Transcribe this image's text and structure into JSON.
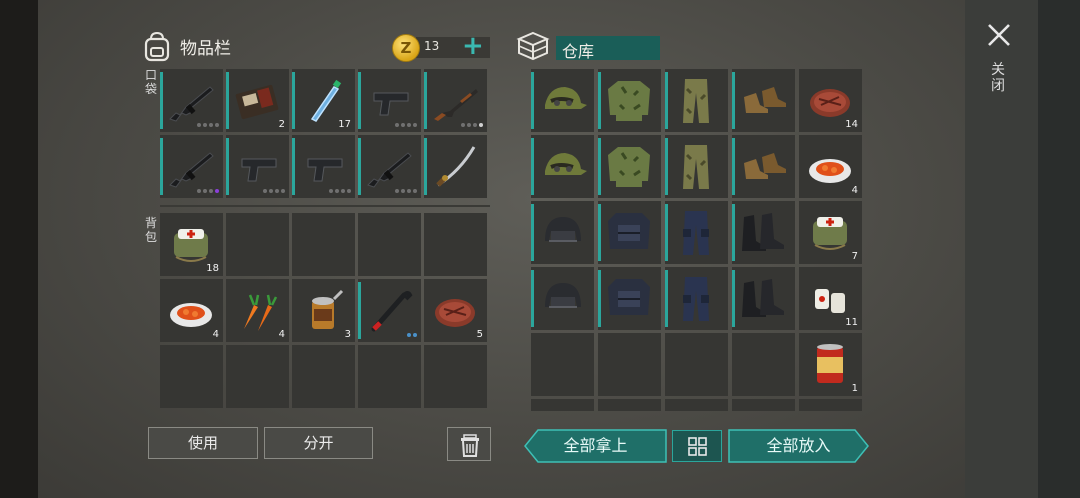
{
  "inventory": {
    "title": "物品栏",
    "coins": "13",
    "plus_label": "+",
    "pocket_label": "口袋",
    "backpack_label": "背包",
    "pocket_slots": [
      {
        "item": "assault-rifle",
        "qty": "",
        "dots": [
          "g",
          "g",
          "g",
          "g"
        ]
      },
      {
        "item": "wallet",
        "qty": "2",
        "dots": []
      },
      {
        "item": "water-bottle",
        "qty": "17",
        "dots": []
      },
      {
        "item": "pistol",
        "qty": "",
        "dots": [
          "g",
          "g",
          "g",
          "g"
        ]
      },
      {
        "item": "ak-rifle",
        "qty": "",
        "dots": [
          "g",
          "g",
          "g",
          "w"
        ]
      },
      {
        "item": "assault-rifle",
        "qty": "",
        "dots": [
          "g",
          "g",
          "g",
          "p"
        ]
      },
      {
        "item": "pistol",
        "qty": "",
        "dots": [
          "g",
          "g",
          "g",
          "g"
        ]
      },
      {
        "item": "pistol",
        "qty": "",
        "dots": [
          "g",
          "g",
          "g",
          "g"
        ]
      },
      {
        "item": "assault-rifle",
        "qty": "",
        "dots": [
          "g",
          "g",
          "g",
          "g"
        ]
      },
      {
        "item": "katana",
        "qty": "",
        "dots": []
      }
    ],
    "backpack_slots": [
      {
        "item": "medkit",
        "qty": "18",
        "dots": []
      },
      {
        "item": "",
        "qty": "",
        "dots": []
      },
      {
        "item": "",
        "qty": "",
        "dots": []
      },
      {
        "item": "",
        "qty": "",
        "dots": []
      },
      {
        "item": "",
        "qty": "",
        "dots": []
      },
      {
        "item": "carrot-stew",
        "qty": "4",
        "dots": []
      },
      {
        "item": "carrots",
        "qty": "4",
        "dots": []
      },
      {
        "item": "open-can",
        "qty": "3",
        "dots": []
      },
      {
        "item": "crowbar",
        "qty": "",
        "dots": [
          "b",
          "b"
        ]
      },
      {
        "item": "steak",
        "qty": "5",
        "dots": []
      },
      {
        "item": "",
        "qty": "",
        "dots": []
      },
      {
        "item": "",
        "qty": "",
        "dots": []
      },
      {
        "item": "",
        "qty": "",
        "dots": []
      },
      {
        "item": "",
        "qty": "",
        "dots": []
      },
      {
        "item": "",
        "qty": "",
        "dots": []
      }
    ],
    "use_label": "使用",
    "split_label": "分开"
  },
  "warehouse": {
    "title": "仓库",
    "slots": [
      {
        "item": "camo-cap",
        "qty": "",
        "mark": true
      },
      {
        "item": "camo-jacket",
        "qty": "",
        "mark": true
      },
      {
        "item": "camo-pants",
        "qty": "",
        "mark": true
      },
      {
        "item": "leather-boots",
        "qty": "",
        "mark": true
      },
      {
        "item": "steak",
        "qty": "14",
        "mark": false
      },
      {
        "item": "camo-cap",
        "qty": "",
        "mark": true
      },
      {
        "item": "camo-jacket",
        "qty": "",
        "mark": true
      },
      {
        "item": "camo-pants",
        "qty": "",
        "mark": true
      },
      {
        "item": "leather-boots",
        "qty": "",
        "mark": true
      },
      {
        "item": "carrot-stew",
        "qty": "4",
        "mark": false
      },
      {
        "item": "swat-helmet",
        "qty": "",
        "mark": true
      },
      {
        "item": "swat-vest",
        "qty": "",
        "mark": true
      },
      {
        "item": "swat-pants",
        "qty": "",
        "mark": true
      },
      {
        "item": "black-boots",
        "qty": "",
        "mark": true
      },
      {
        "item": "medkit",
        "qty": "7",
        "mark": false
      },
      {
        "item": "swat-helmet",
        "qty": "",
        "mark": true
      },
      {
        "item": "swat-vest",
        "qty": "",
        "mark": true
      },
      {
        "item": "swat-pants",
        "qty": "",
        "mark": true
      },
      {
        "item": "black-boots",
        "qty": "",
        "mark": true
      },
      {
        "item": "bandages",
        "qty": "11",
        "mark": false
      },
      {
        "item": "",
        "qty": "",
        "mark": false
      },
      {
        "item": "",
        "qty": "",
        "mark": false
      },
      {
        "item": "",
        "qty": "",
        "mark": false
      },
      {
        "item": "",
        "qty": "",
        "mark": false
      },
      {
        "item": "canned-food",
        "qty": "1",
        "mark": false
      }
    ],
    "take_all_label": "全部拿上",
    "put_all_label": "全部放入"
  },
  "close_label": "关闭",
  "colors": {
    "accent": "#2ba69c",
    "slot": "#363633",
    "background": "#4b4a45"
  }
}
